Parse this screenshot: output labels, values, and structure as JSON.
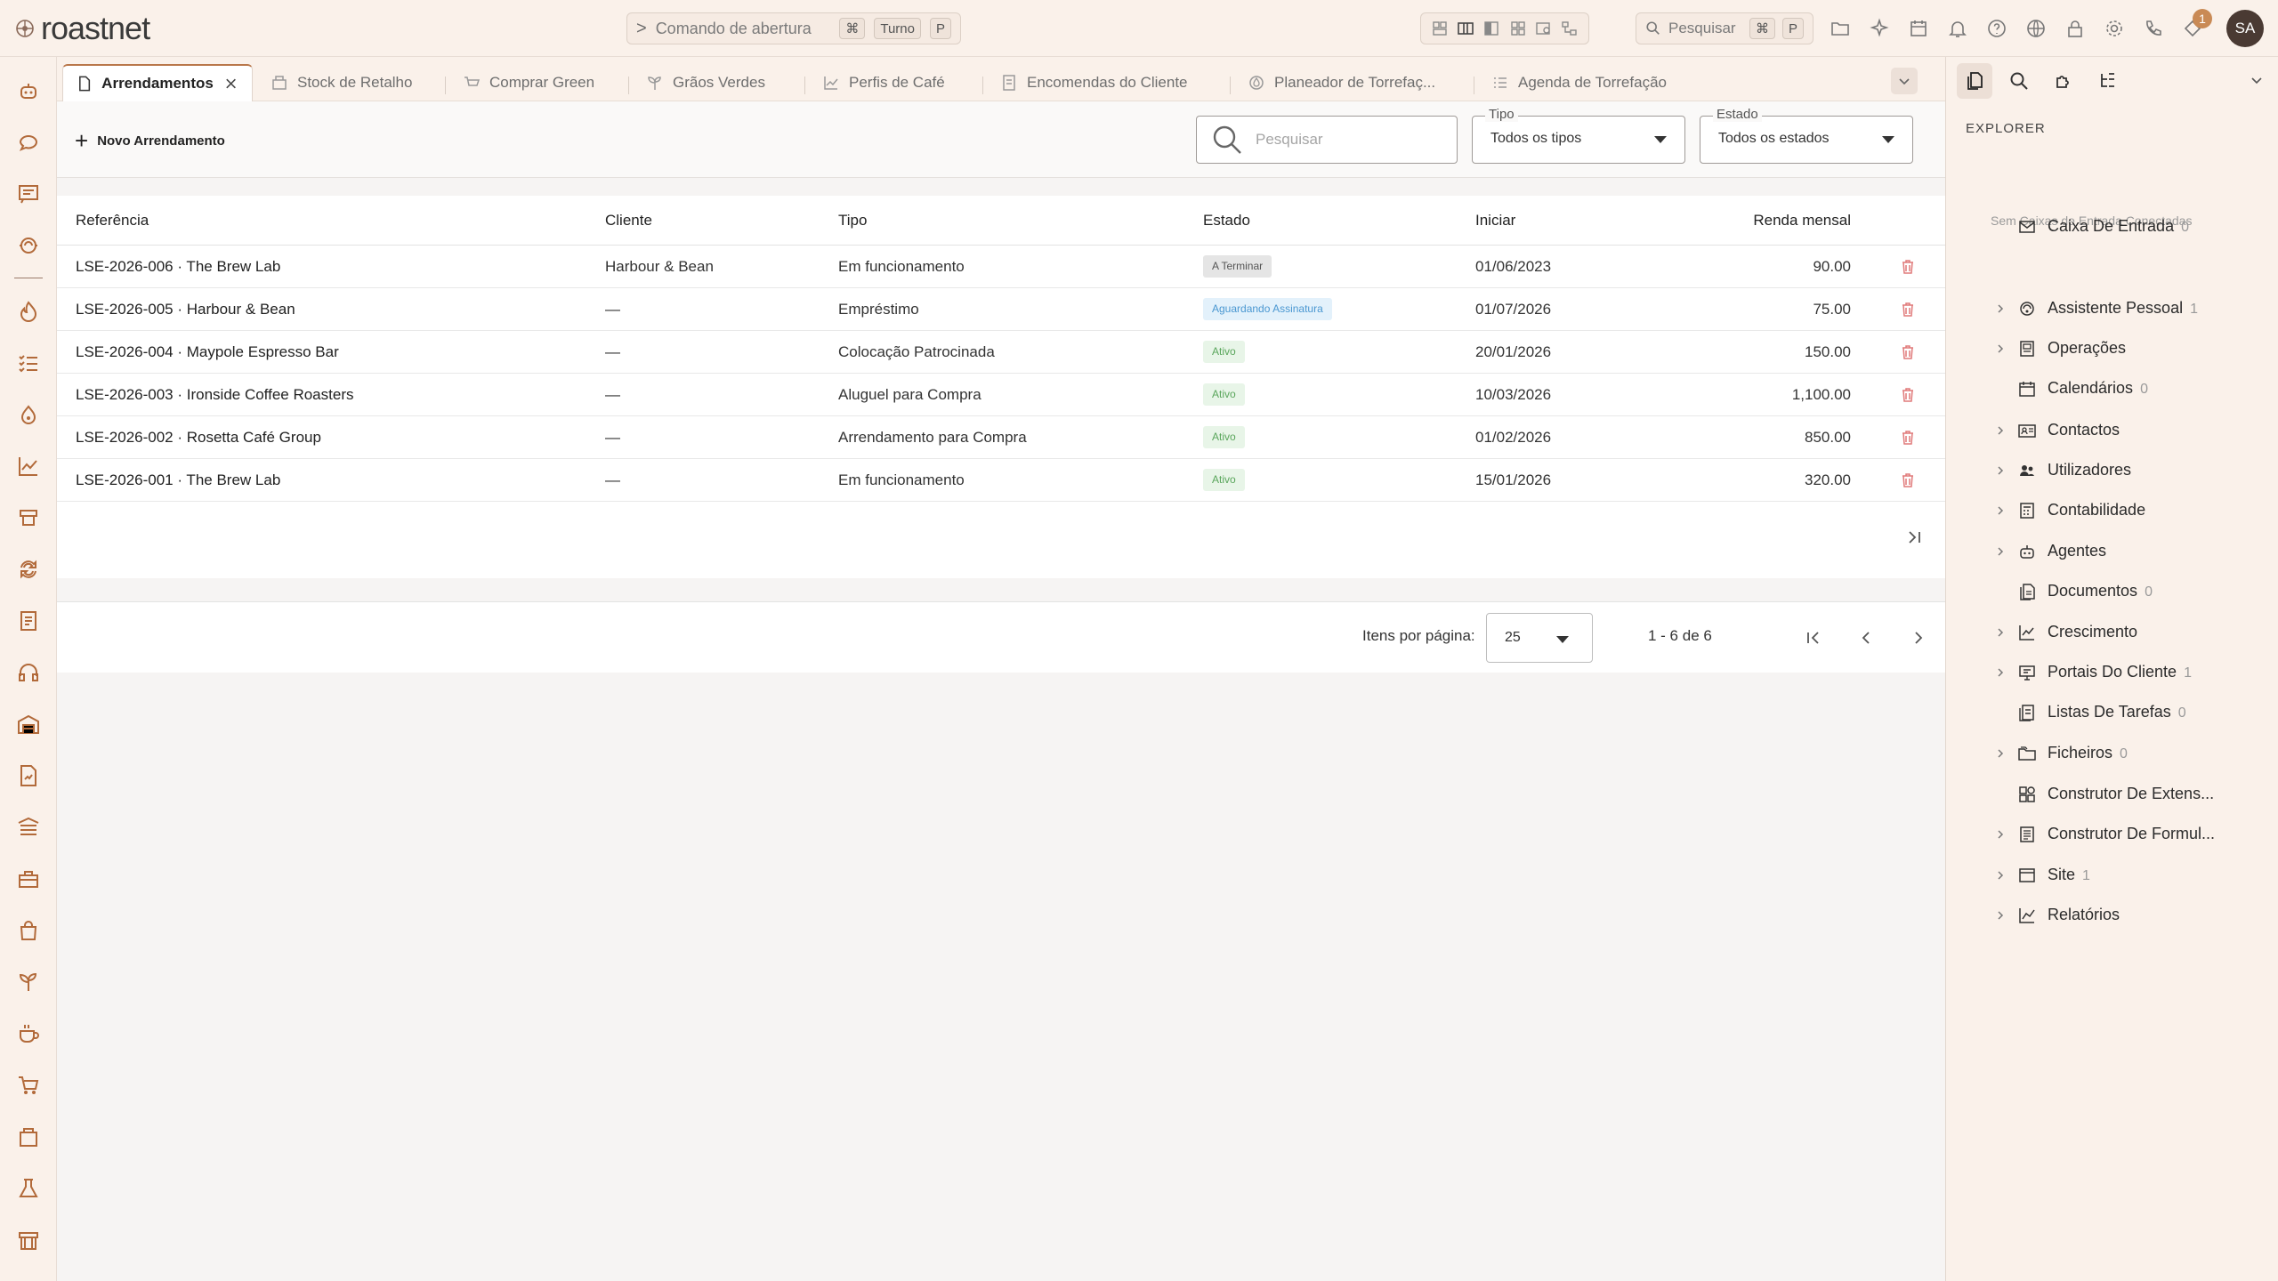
{
  "app": {
    "logo_text": "roastnet"
  },
  "topbar": {
    "command_placeholder": "Comando de abertura",
    "command_keys": [
      "⌘",
      "Turno",
      "P"
    ],
    "search_label": "Pesquisar",
    "search_keys": [
      "⌘",
      "P"
    ],
    "notification_count": "1",
    "avatar_initials": "SA"
  },
  "tabs": [
    {
      "label": "Arrendamentos",
      "icon": "document-icon",
      "active": true
    },
    {
      "label": "Stock de Retalho",
      "icon": "store-icon"
    },
    {
      "label": "Comprar Green",
      "icon": "cart-icon"
    },
    {
      "label": "Grãos Verdes",
      "icon": "sprout-icon"
    },
    {
      "label": "Perfis de Café",
      "icon": "chart-icon"
    },
    {
      "label": "Encomendas do Cliente",
      "icon": "receipt-icon"
    },
    {
      "label": "Planeador de Torrefaç...",
      "icon": "flame-icon"
    },
    {
      "label": "Agenda de Torrefação",
      "icon": "list-icon"
    }
  ],
  "toolbar": {
    "new_label": "Novo Arrendamento",
    "search_placeholder": "Pesquisar",
    "type_label": "Tipo",
    "type_value": "Todos os tipos",
    "state_label": "Estado",
    "state_value": "Todos os estados"
  },
  "table": {
    "columns": {
      "ref": "Referência",
      "client": "Cliente",
      "type": "Tipo",
      "state": "Estado",
      "start": "Iniciar",
      "rent": "Renda mensal"
    },
    "rows": [
      {
        "ref": "LSE-2026-006 · The Brew Lab",
        "client": "Harbour & Bean",
        "type": "Em funcionamento",
        "state": "A Terminar",
        "state_style": "gray",
        "start": "01/06/2023",
        "rent": "90.00"
      },
      {
        "ref": "LSE-2026-005 · Harbour & Bean",
        "client": "—",
        "type": "Empréstimo",
        "state": "Aguardando Assinatura",
        "state_style": "blue",
        "start": "01/07/2026",
        "rent": "75.00"
      },
      {
        "ref": "LSE-2026-004 · Maypole Espresso Bar",
        "client": "—",
        "type": "Colocação Patrocinada",
        "state": "Ativo",
        "state_style": "green",
        "start": "20/01/2026",
        "rent": "150.00"
      },
      {
        "ref": "LSE-2026-003 · Ironside Coffee Roasters",
        "client": "—",
        "type": "Aluguel para Compra",
        "state": "Ativo",
        "state_style": "green",
        "start": "10/03/2026",
        "rent": "1,100.00"
      },
      {
        "ref": "LSE-2026-002 · Rosetta Café Group",
        "client": "—",
        "type": "Arrendamento para Compra",
        "state": "Ativo",
        "state_style": "green",
        "start": "01/02/2026",
        "rent": "850.00"
      },
      {
        "ref": "LSE-2026-001 · The Brew Lab",
        "client": "—",
        "type": "Em funcionamento",
        "state": "Ativo",
        "state_style": "green",
        "start": "15/01/2026",
        "rent": "320.00"
      }
    ]
  },
  "pager": {
    "items_per_page_label": "Itens por página:",
    "items_per_page": "25",
    "range": "1 - 6 de 6"
  },
  "explorer": {
    "title": "EXPLORER",
    "no_inbox_note": "Sem Caixas de Entrada Conectadas",
    "items": [
      {
        "label": "Caixa De Entrada",
        "count": "0",
        "chevron": false,
        "icon": "mail-icon"
      },
      {
        "label": "Assistente Pessoal",
        "count": "1",
        "chevron": true,
        "icon": "assistant-icon"
      },
      {
        "label": "Operações",
        "count": "",
        "chevron": true,
        "icon": "operations-icon"
      },
      {
        "label": "Calendários",
        "count": "0",
        "chevron": false,
        "icon": "calendar-icon"
      },
      {
        "label": "Contactos",
        "count": "",
        "chevron": true,
        "icon": "contact-card-icon"
      },
      {
        "label": "Utilizadores",
        "count": "",
        "chevron": true,
        "icon": "users-icon"
      },
      {
        "label": "Contabilidade",
        "count": "",
        "chevron": true,
        "icon": "calculator-icon"
      },
      {
        "label": "Agentes",
        "count": "",
        "chevron": true,
        "icon": "robot-icon"
      },
      {
        "label": "Documentos",
        "count": "0",
        "chevron": false,
        "icon": "documents-icon"
      },
      {
        "label": "Crescimento",
        "count": "",
        "chevron": true,
        "icon": "growth-chart-icon"
      },
      {
        "label": "Portais Do Cliente",
        "count": "1",
        "chevron": true,
        "icon": "portal-icon"
      },
      {
        "label": "Listas De Tarefas",
        "count": "0",
        "chevron": false,
        "icon": "task-list-icon"
      },
      {
        "label": "Ficheiros",
        "count": "0",
        "chevron": true,
        "icon": "folder-icon"
      },
      {
        "label": "Construtor De Extens...",
        "count": "",
        "chevron": false,
        "icon": "extension-icon"
      },
      {
        "label": "Construtor De Formul...",
        "count": "",
        "chevron": true,
        "icon": "form-icon"
      },
      {
        "label": "Site",
        "count": "1",
        "chevron": true,
        "icon": "browser-icon"
      },
      {
        "label": "Relatórios",
        "count": "",
        "chevron": true,
        "icon": "report-chart-icon"
      }
    ]
  },
  "colors": {
    "accent": "#b9774a",
    "badge_green": "#5aa65c",
    "badge_blue": "#4a97d1",
    "trash": "#e07a7a"
  }
}
